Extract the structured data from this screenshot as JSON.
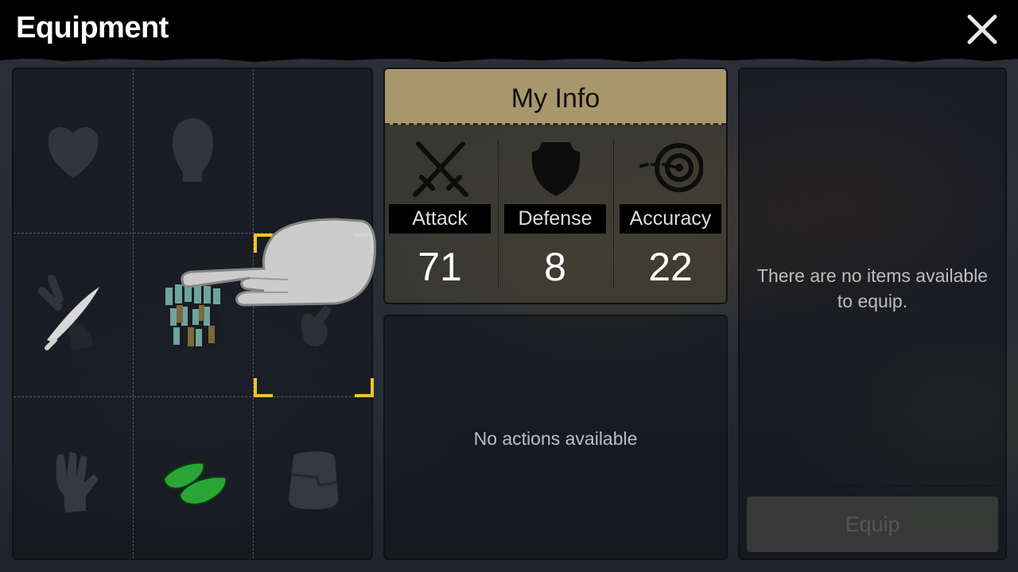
{
  "header": {
    "title": "Equipment"
  },
  "equipment_grid": {
    "slots": [
      {
        "name": "chest-slot",
        "equipped": false,
        "icon": "heart-icon"
      },
      {
        "name": "head-slot",
        "equipped": false,
        "icon": "head-icon"
      },
      {
        "name": "empty-slot",
        "equipped": false,
        "icon": ""
      },
      {
        "name": "weapon-slot",
        "equipped": true,
        "icon": "machete-icon"
      },
      {
        "name": "body-slot",
        "equipped": true,
        "icon": "ghillie-armor-icon"
      },
      {
        "name": "offhand-slot",
        "equipped": false,
        "icon": "hand-icon",
        "selected": true
      },
      {
        "name": "gloves-slot",
        "equipped": false,
        "icon": "gloves-icon"
      },
      {
        "name": "shoes-slot",
        "equipped": true,
        "icon": "green-shoes-icon"
      },
      {
        "name": "bag-slot",
        "equipped": false,
        "icon": "bag-icon"
      }
    ]
  },
  "my_info": {
    "title": "My Info",
    "stats": [
      {
        "label": "Attack",
        "value": "71",
        "icon": "crossed-swords-icon"
      },
      {
        "label": "Defense",
        "value": "8",
        "icon": "shield-icon"
      },
      {
        "label": "Accuracy",
        "value": "22",
        "icon": "target-icon"
      }
    ]
  },
  "actions": {
    "message": "No actions available"
  },
  "equip_panel": {
    "message_line1": "There are no items available",
    "message_line2": "to equip.",
    "equip_label": "Equip"
  },
  "colors": {
    "selection": "#f2c230",
    "header_band": "#a8976c"
  }
}
